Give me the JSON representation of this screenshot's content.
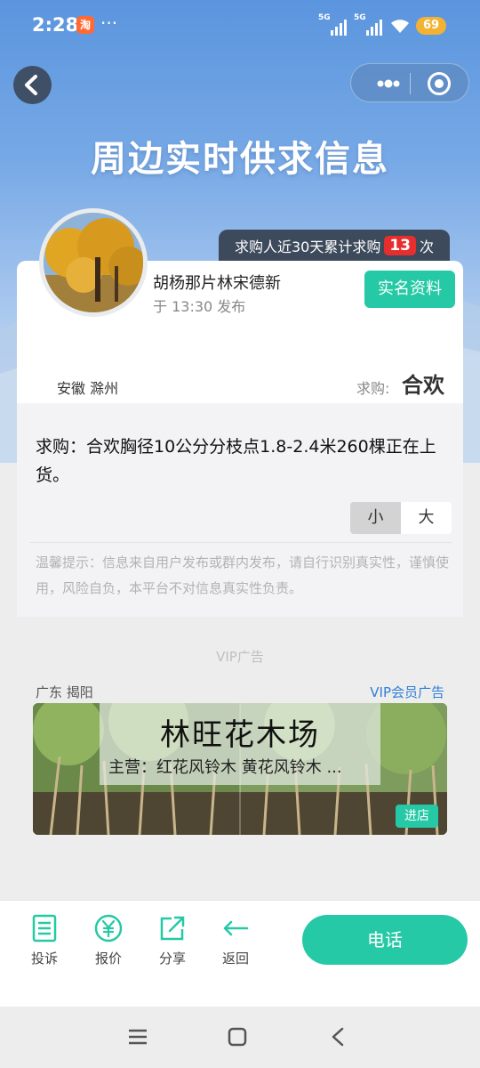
{
  "status_bar": {
    "time": "2:28",
    "app_badge": "淘",
    "more": "···",
    "network_1": "5G",
    "network_2": "5G",
    "battery": "69"
  },
  "header": {
    "title": "周边实时供求信息"
  },
  "card": {
    "count_prefix": "求购人近30天累计求购",
    "count_value": "13",
    "count_suffix": "次",
    "poster_name": "胡杨那片林宋德新",
    "post_time": "于 13:30 发布",
    "realname_button": "实名资料",
    "location": "安徽 滁州",
    "buy_label": "求购:",
    "buy_value": "合欢"
  },
  "detail": {
    "text": "求购：合欢胸径10公分分枝点1.8-2.4米260棵正在上货。",
    "size_small": "小",
    "size_large": "大",
    "notice": "温馨提示：信息来自用户发布或群内发布，请自行识别真实性，谨慎使用，风险自负，本平台不对信息真实性负责。"
  },
  "ad": {
    "section_label": "VIP广告",
    "location": "广东 揭阳",
    "vip_link": "VIP会员广告",
    "name": "林旺花木场",
    "main_business": "主营：红花风铃木 黄花风铃木 ...",
    "enter_button": "进店"
  },
  "bottom_bar": {
    "items": [
      {
        "label": "投诉",
        "icon": "complaint-icon"
      },
      {
        "label": "报价",
        "icon": "yen-icon"
      },
      {
        "label": "分享",
        "icon": "share-icon"
      },
      {
        "label": "返回",
        "icon": "back-arrow-icon"
      }
    ],
    "phone_button": "电话"
  },
  "colors": {
    "accent": "#26c9a5",
    "badge_red": "#e62e2e",
    "link_blue": "#2f7fd6",
    "hero_blue": "#5b95de"
  }
}
